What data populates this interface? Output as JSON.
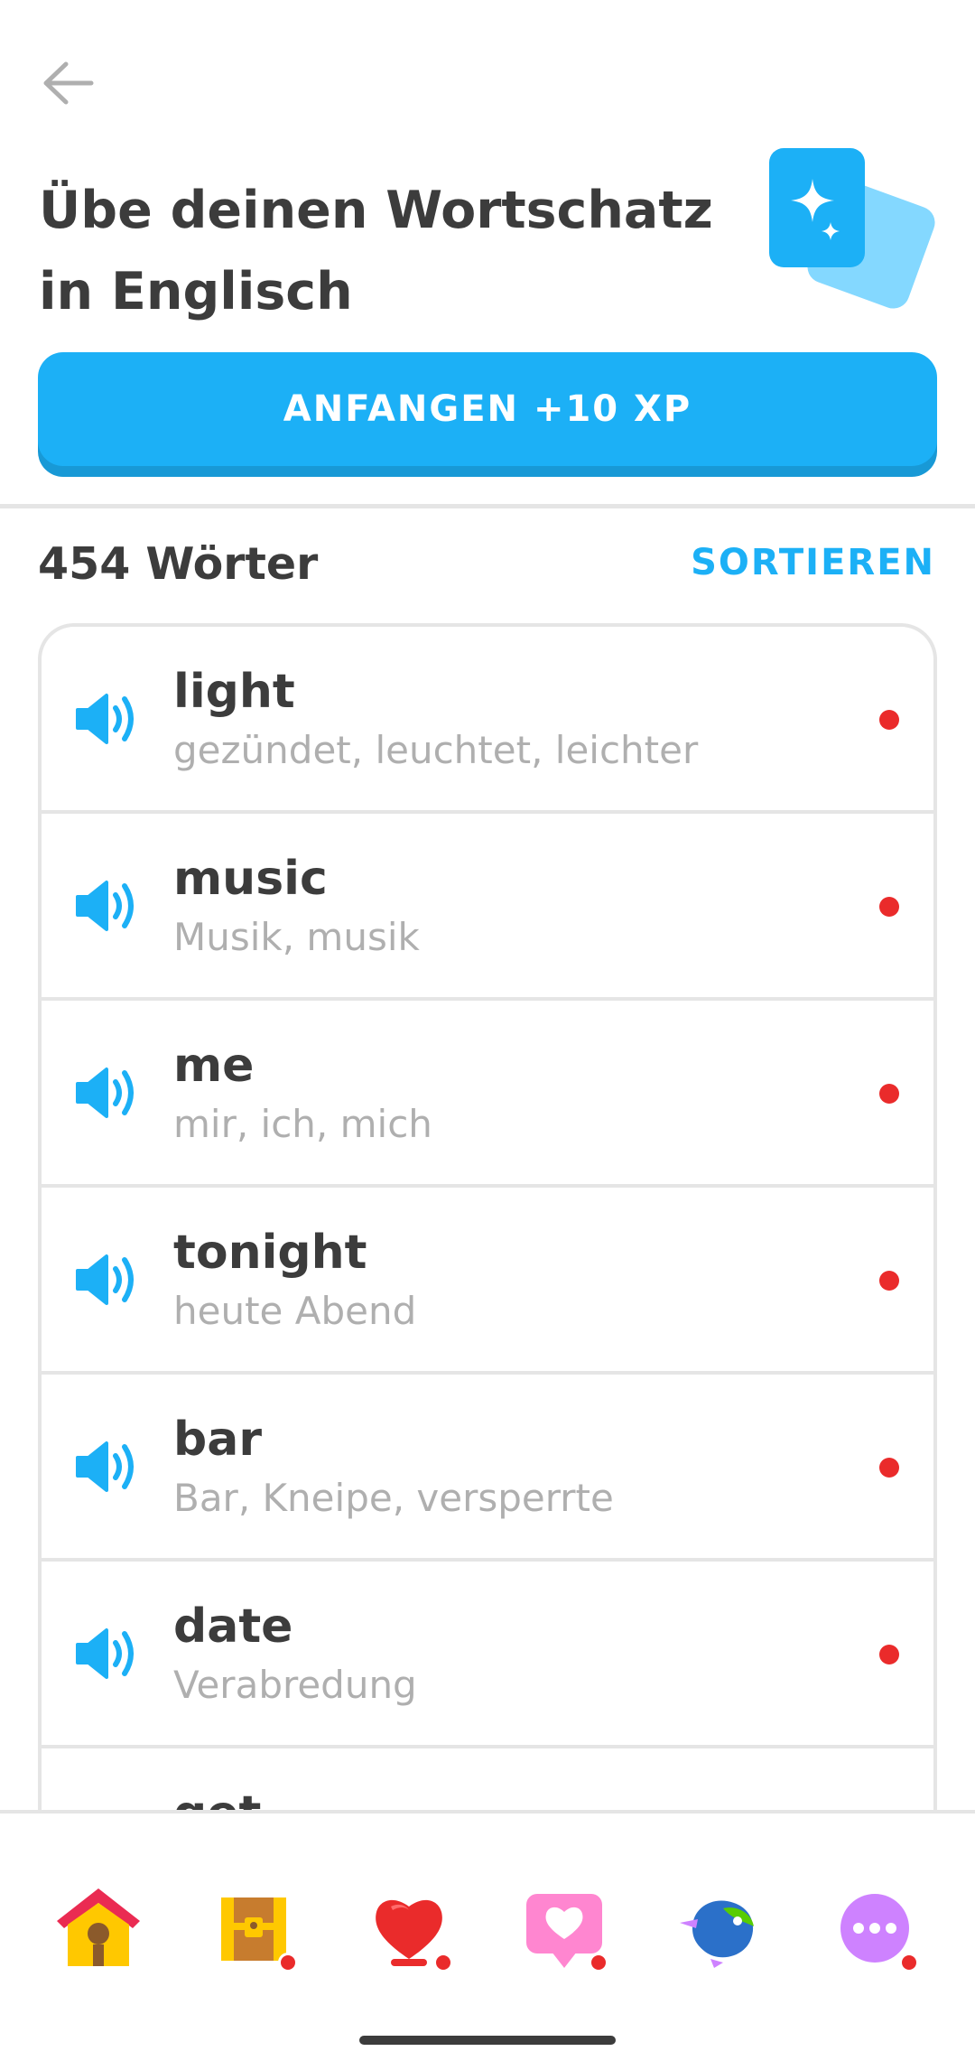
{
  "header": {
    "title": "Übe deinen Wortschatz in Englisch",
    "start_button": "ANFANGEN +10 XP"
  },
  "words": {
    "count_label": "454 Wörter",
    "sort_label": "SORTIEREN",
    "items": [
      {
        "word": "light",
        "translation": "gezündet, leuchtet, leichter"
      },
      {
        "word": "music",
        "translation": "Musik, musik"
      },
      {
        "word": "me",
        "translation": "mir, ich, mich"
      },
      {
        "word": "tonight",
        "translation": "heute Abend"
      },
      {
        "word": "bar",
        "translation": "Bar, Kneipe, versperrte"
      },
      {
        "word": "date",
        "translation": "Verabredung"
      },
      {
        "word": "get",
        "translation": ""
      }
    ]
  },
  "nav": {
    "items": [
      {
        "name": "home-icon",
        "badge": false
      },
      {
        "name": "treasure-chest-icon",
        "badge": true
      },
      {
        "name": "league-icon",
        "badge": true
      },
      {
        "name": "heart-chat-icon",
        "badge": true
      },
      {
        "name": "bird-icon",
        "badge": false
      },
      {
        "name": "more-icon",
        "badge": true
      }
    ]
  },
  "colors": {
    "accent": "#1cb0f6",
    "accent_dark": "#1899d6",
    "text": "#3c3c3c",
    "subtext": "#afafaf",
    "badge": "#ea2b2b",
    "border": "#e5e5e5"
  }
}
